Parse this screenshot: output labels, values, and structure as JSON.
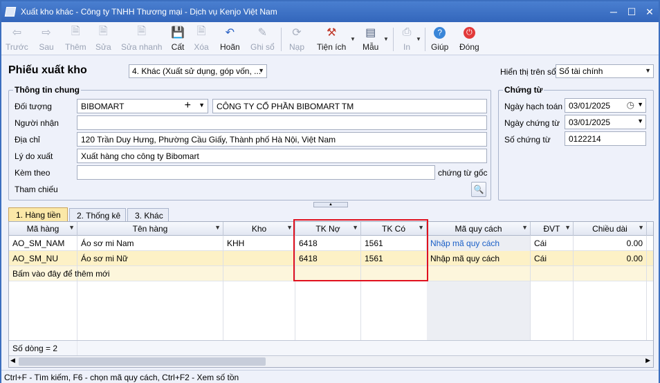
{
  "window": {
    "title": "Xuất kho khác - Công ty TNHH Thương mại - Dịch vụ Kenjo Việt Nam"
  },
  "toolbar": {
    "truoc": "Trước",
    "sau": "Sau",
    "them": "Thêm",
    "sua": "Sửa",
    "sua_nhanh": "Sửa nhanh",
    "cat": "Cất",
    "xoa": "Xóa",
    "hoan": "Hoãn",
    "ghi_so": "Ghi sổ",
    "nap": "Nạp",
    "tien_ich": "Tiện ích",
    "mau": "Mẫu",
    "in": "In",
    "giup": "Giúp",
    "dong": "Đóng"
  },
  "header": {
    "title": "Phiếu xuất kho",
    "type_value": "4. Khác (Xuất sử dụng, góp vốn, ...",
    "display_label": "Hiển thị trên sổ",
    "display_value": "Sổ tài chính"
  },
  "general": {
    "title": "Thông tin chung",
    "doi_tuong_label": "Đối tượng",
    "doi_tuong_code": "BIBOMART",
    "doi_tuong_name": "CÔNG TY CỔ PHẦN BIBOMART TM",
    "nguoi_nhan_label": "Người nhận",
    "nguoi_nhan_value": "",
    "dia_chi_label": "Địa chỉ",
    "dia_chi_value": "120 Trần Duy Hưng, Phường Cầu Giấy, Thành phố Hà Nội, Việt Nam",
    "ly_do_label": "Lý do xuất",
    "ly_do_value": "Xuất hàng cho công ty Bibomart",
    "kem_theo_label": "Kèm theo",
    "kem_theo_value": "",
    "chung_tu_goc": "chứng từ gốc",
    "tham_chieu_label": "Tham chiếu"
  },
  "voucher": {
    "title": "Chứng từ",
    "ngay_hach_toan_label": "Ngày hạch toán",
    "ngay_hach_toan": "03/01/2025",
    "ngay_chung_tu_label": "Ngày chứng từ",
    "ngay_chung_tu": "03/01/2025",
    "so_chung_tu_label": "Số chứng từ",
    "so_chung_tu": "0122214"
  },
  "tabs": [
    {
      "label": "1. Hàng tiền"
    },
    {
      "label": "2. Thống kê"
    },
    {
      "label": "3. Khác"
    }
  ],
  "grid": {
    "columns": [
      "Mã hàng",
      "Tên hàng",
      "Kho",
      "TK Nợ",
      "TK Có",
      "Mã quy cách",
      "ĐVT",
      "Chiều dài"
    ],
    "rows": [
      [
        "AO_SM_NAM",
        "Áo sơ mi Nam",
        "KHH",
        "6418",
        "1561",
        "Nhập mã quy cách",
        "Cái",
        "0.00"
      ],
      [
        "AO_SM_NU",
        "Áo sơ mi Nữ",
        "",
        "6418",
        "1561",
        "Nhập mã quy cách",
        "Cái",
        "0.00"
      ]
    ],
    "add_hint": "Bấm vào đây để thêm mới",
    "row_count": "Số dòng = 2"
  },
  "status": {
    "text": "Ctrl+F - Tìm kiếm, F6 - chọn mã quy cách, Ctrl+F2 - Xem số tồn"
  },
  "colors": {
    "title_bar": "#3a6fc4",
    "selected_row": "#fdf1c6",
    "highlight_box": "#e0101e",
    "link": "#1a5fc7"
  }
}
